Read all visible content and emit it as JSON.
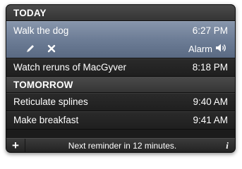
{
  "today": {
    "header": "TODAY",
    "items": [
      {
        "title": "Walk the dog",
        "time": "6:27 PM",
        "alarm_label": "Alarm"
      },
      {
        "title": "Watch reruns of MacGyver",
        "time": "8:18 PM"
      }
    ]
  },
  "tomorrow": {
    "header": "TOMORROW",
    "items": [
      {
        "title": "Reticulate splines",
        "time": "9:40 AM"
      },
      {
        "title": "Make breakfast",
        "time": "9:41 AM"
      }
    ]
  },
  "footer": {
    "add_label": "+",
    "status": "Next reminder in 12 minutes.",
    "info_label": "i"
  },
  "icons": {
    "edit": "pencil-icon",
    "delete": "close-icon",
    "alarm": "speaker-icon"
  },
  "colors": {
    "selected_row": "#7b8aa2",
    "header_bg": "#3f3f3f",
    "row_bg": "#242424"
  }
}
